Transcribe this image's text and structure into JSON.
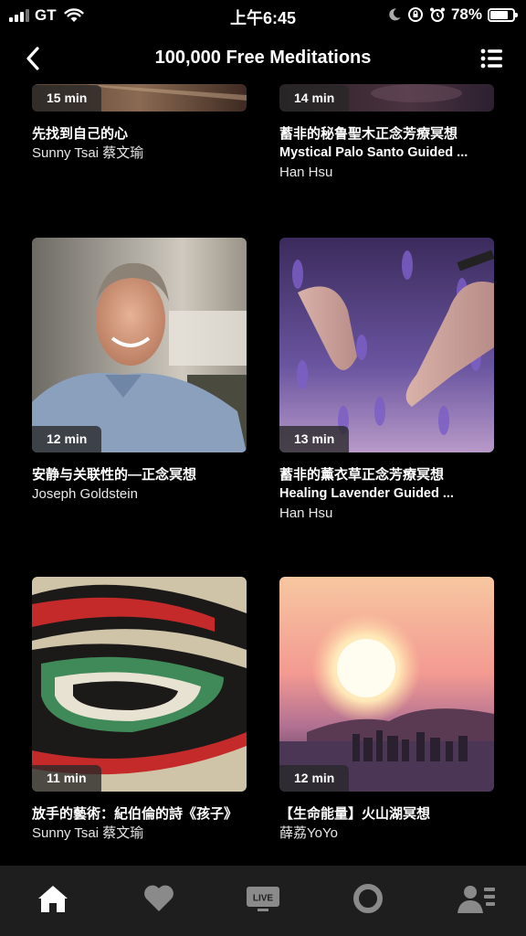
{
  "status_bar": {
    "carrier": "GT",
    "time": "上午6:45",
    "battery_percent": "78%",
    "battery_level": 0.78
  },
  "nav": {
    "title": "100,000 Free Meditations",
    "back_icon": "chevron-left-icon",
    "list_icon": "list-icon"
  },
  "cards": [
    {
      "duration": "15 min",
      "title": "先找到自己的心",
      "subtitle": "",
      "author": "Sunny Tsai 蔡文瑜"
    },
    {
      "duration": "14 min",
      "title": "蓄非的秘鲁聖木正念芳療冥想",
      "subtitle": "Mystical Palo Santo Guided ...",
      "author": "Han Hsu"
    },
    {
      "duration": "12 min",
      "title": "安静与关联性的—正念冥想",
      "subtitle": "",
      "author": "Joseph Goldstein"
    },
    {
      "duration": "13 min",
      "title": "蓄非的薰衣草正念芳療冥想",
      "subtitle": "Healing Lavender Guided ...",
      "author": "Han Hsu"
    },
    {
      "duration": "11 min",
      "title": "放手的藝術：紀伯倫的詩《孩子》",
      "subtitle": "",
      "author": "Sunny Tsai 蔡文瑜"
    },
    {
      "duration": "12 min",
      "title": "【生命能量】火山湖冥想",
      "subtitle": "",
      "author": "薛荔YoYo"
    }
  ],
  "tab_bar": {
    "items": [
      {
        "icon": "home-icon",
        "active": true
      },
      {
        "icon": "heart-icon",
        "active": false
      },
      {
        "icon": "live-icon",
        "label": "LIVE",
        "active": false
      },
      {
        "icon": "circle-icon",
        "active": false
      },
      {
        "icon": "profile-icon",
        "active": false
      }
    ]
  },
  "colors": {
    "background": "#000000",
    "tab_bar": "#1e1e1e",
    "inactive_icon": "#8a8a8a",
    "active_icon": "#ffffff"
  }
}
